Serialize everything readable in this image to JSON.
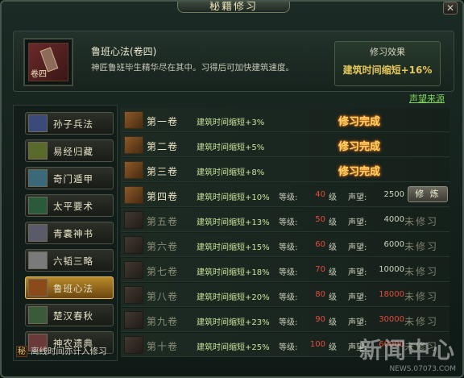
{
  "window": {
    "title": "秘籍修习",
    "close_icon": "close-icon"
  },
  "book": {
    "name": "鲁班心法(卷四)",
    "cover_label": "卷四",
    "description": "神匠鲁班毕生精华尽在其中。习得后可加快建筑速度。",
    "effect_label": "修习效果",
    "effect_value": "建筑时间缩短+16%"
  },
  "prestige_link": "声望来源",
  "books": [
    {
      "name": "孙子兵法",
      "active": false
    },
    {
      "name": "易经归藏",
      "active": false
    },
    {
      "name": "奇门遁甲",
      "active": false
    },
    {
      "name": "太平要术",
      "active": false
    },
    {
      "name": "青囊神书",
      "active": false
    },
    {
      "name": "六韬三略",
      "active": false
    },
    {
      "name": "鲁班心法",
      "active": true
    },
    {
      "name": "楚汉春秋",
      "active": false
    },
    {
      "name": "神农遗典",
      "active": false
    }
  ],
  "volumes": [
    {
      "name": "第一卷",
      "effect": "建筑时间缩短+3%",
      "status": "修习完成"
    },
    {
      "name": "第二卷",
      "effect": "建筑时间缩短+5%",
      "status": "修习完成"
    },
    {
      "name": "第三卷",
      "effect": "建筑时间缩短+8%",
      "status": "修习完成"
    },
    {
      "name": "第四卷",
      "effect": "建筑时间缩短+10%",
      "level_label": "等级:",
      "level": "40",
      "level_unit": "级",
      "prestige_label": "声望:",
      "prestige": "2500",
      "action": "修 炼"
    },
    {
      "name": "第五卷",
      "effect": "建筑时间缩短+13%",
      "level_label": "等级:",
      "level": "50",
      "level_unit": "级",
      "prestige_label": "声望:",
      "prestige": "4000",
      "status": "未修习"
    },
    {
      "name": "第六卷",
      "effect": "建筑时间缩短+15%",
      "level_label": "等级:",
      "level": "60",
      "level_unit": "级",
      "prestige_label": "声望:",
      "prestige": "6000",
      "status": "未修习"
    },
    {
      "name": "第七卷",
      "effect": "建筑时间缩短+18%",
      "level_label": "等级:",
      "level": "70",
      "level_unit": "级",
      "prestige_label": "声望:",
      "prestige": "10000",
      "status": "未修习"
    },
    {
      "name": "第八卷",
      "effect": "建筑时间缩短+20%",
      "level_label": "等级:",
      "level": "80",
      "level_unit": "级",
      "prestige_label": "声望:",
      "prestige": "18000",
      "status": "未修习"
    },
    {
      "name": "第九卷",
      "effect": "建筑时间缩短+23%",
      "level_label": "等级:",
      "level": "90",
      "level_unit": "级",
      "prestige_label": "声望:",
      "prestige": "30000",
      "status": "未修习"
    },
    {
      "name": "第十卷",
      "effect": "建筑时间缩短+25%",
      "level_label": "等级:",
      "level": "100",
      "level_unit": "级",
      "prestige_label": "声望:",
      "prestige": "60000",
      "status": "未修习"
    }
  ],
  "footer": {
    "seal": "秘",
    "note": "离线时间亦计入修习"
  },
  "watermark": {
    "main": "新闻中心",
    "sub": "NEWS.07073.COM"
  },
  "colors": {
    "gold": "#e5c65a",
    "red": "#e24b3a",
    "green_link": "#7fd45a",
    "done_glow": "#e26a10"
  }
}
